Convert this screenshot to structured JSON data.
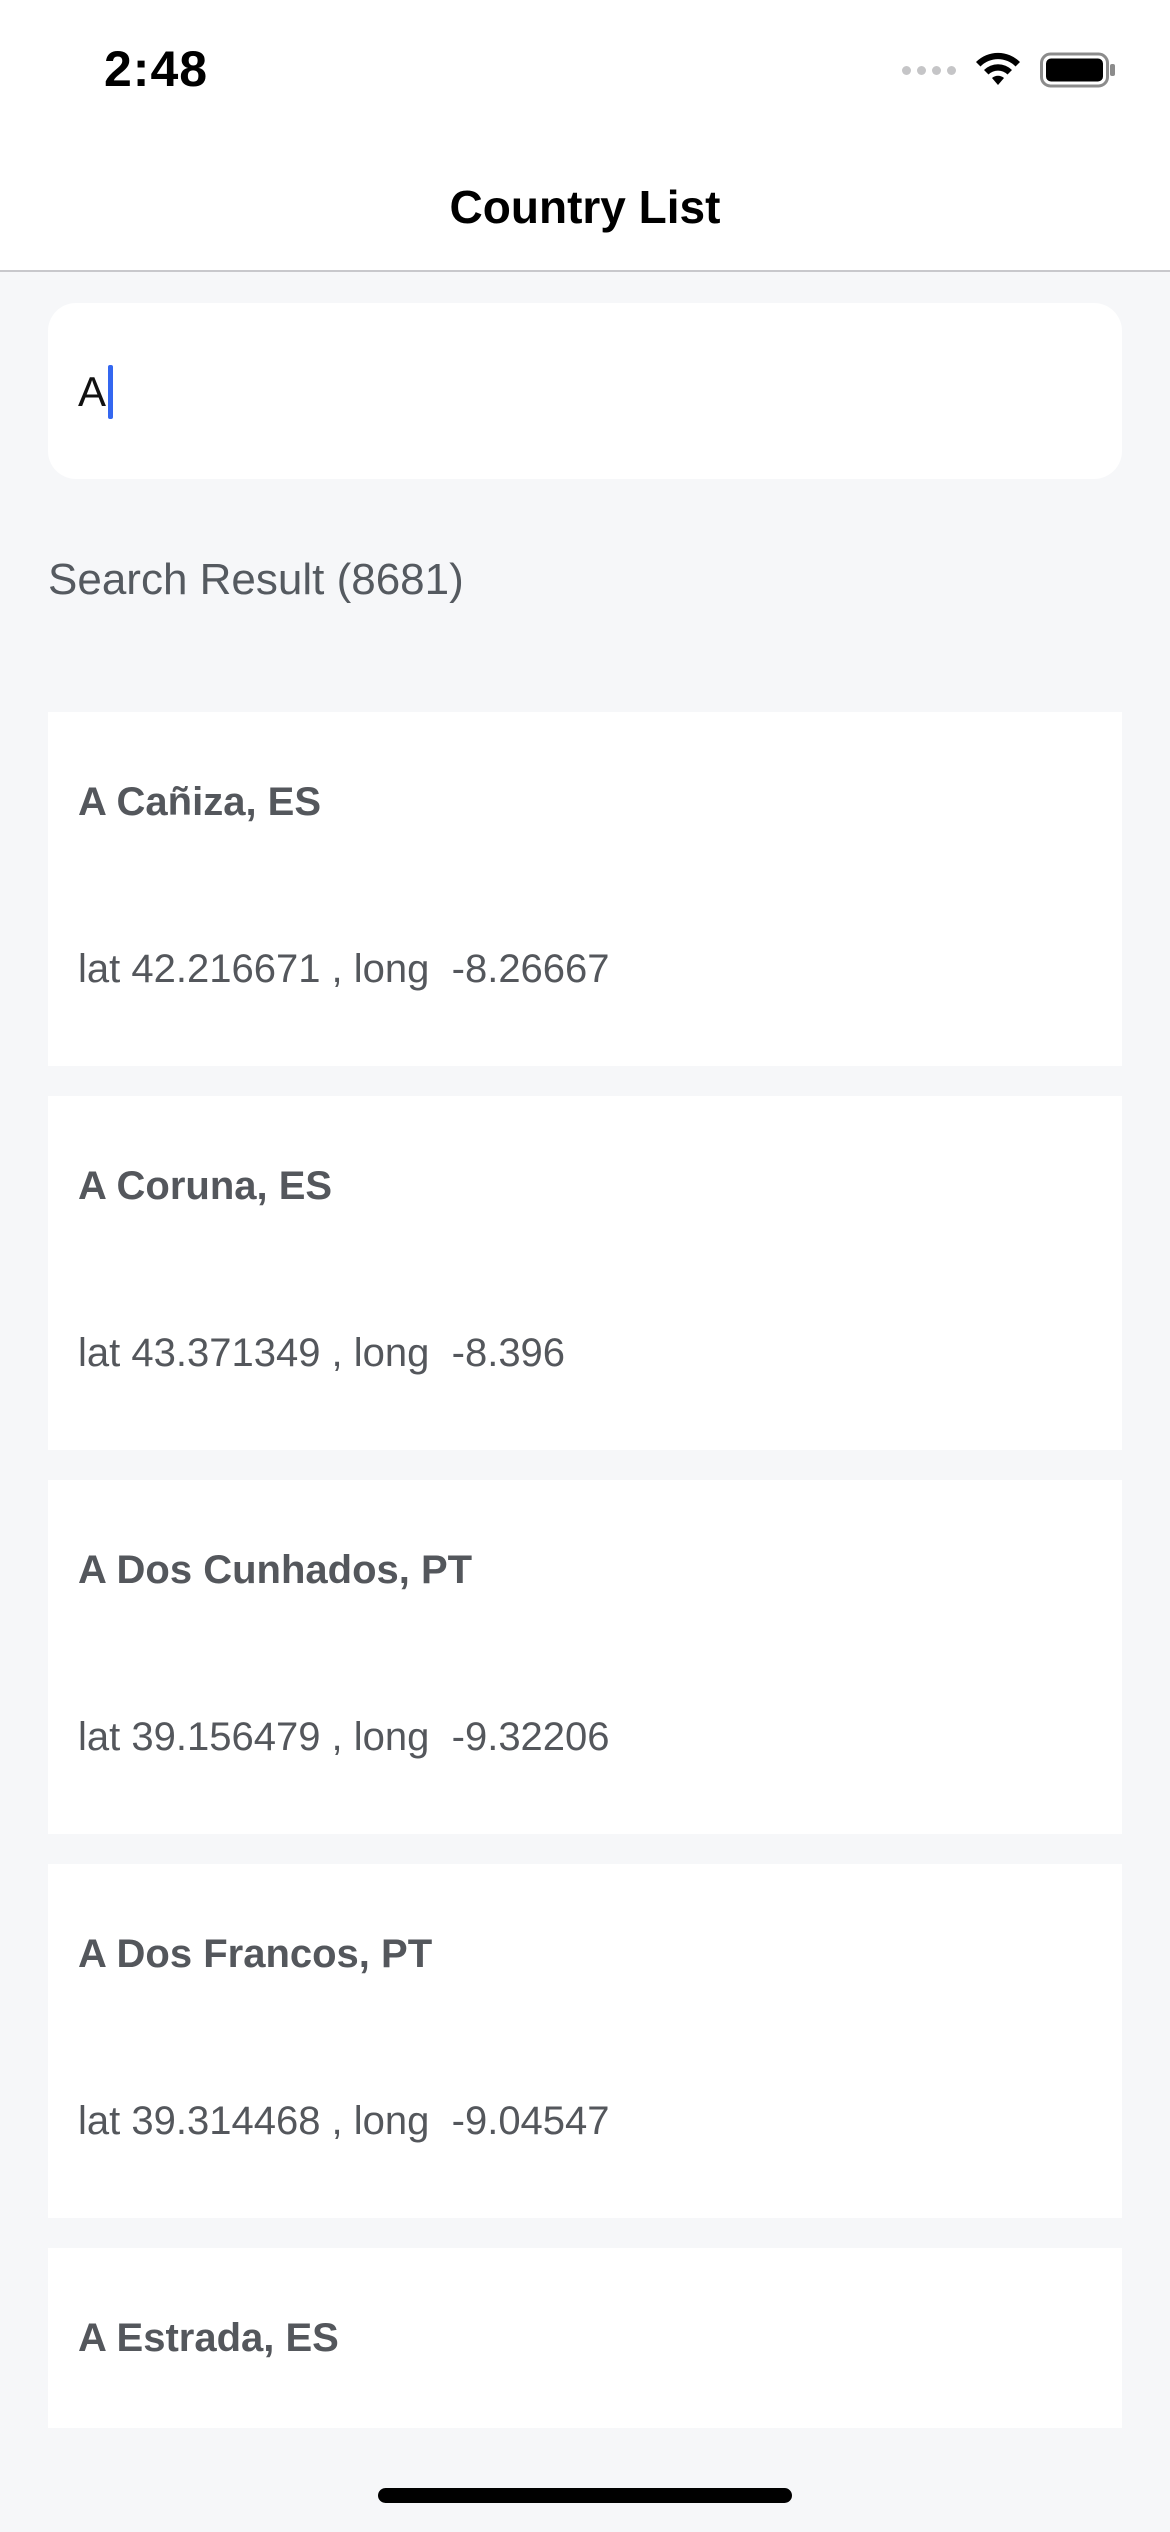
{
  "status_bar": {
    "time": "2:48",
    "icons": [
      "signal-icon",
      "wifi-icon",
      "battery-icon"
    ]
  },
  "nav": {
    "title": "Country List"
  },
  "search": {
    "value": "A"
  },
  "results": {
    "label": "Search Result (8681)"
  },
  "cards": [
    {
      "title": "A Cañiza, ES",
      "coords": "lat 42.216671 , long  -8.26667"
    },
    {
      "title": "A Coruna, ES",
      "coords": "lat 43.371349 , long  -8.396"
    },
    {
      "title": "A Dos Cunhados, PT",
      "coords": "lat 39.156479 , long  -9.32206"
    },
    {
      "title": "A Dos Francos, PT",
      "coords": "lat 39.314468 , long  -9.04547"
    },
    {
      "title": "A Estrada, ES",
      "coords": ""
    }
  ]
}
